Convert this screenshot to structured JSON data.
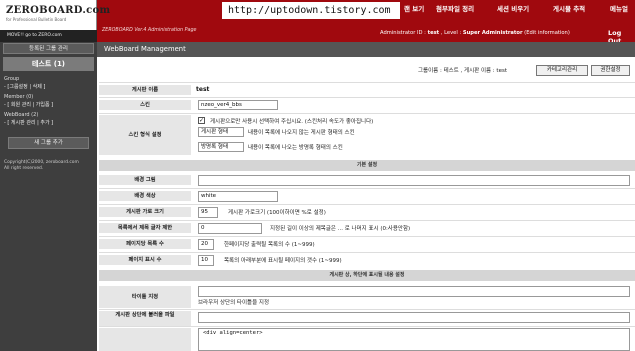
{
  "header": {
    "logo_title": "ZEROBOARD.com",
    "logo_subtitle": "for Professional Bulletin Board",
    "logo_link": "MOVE!! go to ZERO.com",
    "admin_subtitle": "ZEROBOARD Ver.4 Administration Page",
    "url_overlay": "http://uptodown.tistory.com",
    "menu": [
      "랜 보기",
      "첨부파일 정리",
      "세션 비우기",
      "게시물 추적",
      "메뉴얼"
    ],
    "logout": "Log Out",
    "admin_id_label": "Administrator ID :",
    "admin_id": "test",
    "level_label": ", Level :",
    "level": "Super Administrator",
    "edit_info": "(Edit information)"
  },
  "sidebar": {
    "register_group": "등록된 그룹 관리",
    "group_title": "테스트 (1)",
    "group_label": "Group",
    "group_links": "- [그룹설정 | 삭제 ]",
    "member_label": "Member (0)",
    "member_links": "- [ 회원 관리 | 가입폼 ]",
    "webboard_label": "WebBoard (2)",
    "webboard_links": "- [ 게시판 관리 | 추가 ]",
    "add_group": "새 그룹 추가",
    "copyright": "Copyright(C)2000, zeroboard.com",
    "rights": "All right reserved."
  },
  "main": {
    "title": "WebBoard Management",
    "breadcrumb": "그룹이름 : 테스트 , 게시판 이름 : test",
    "btn_category": "카테고리관리",
    "btn_permission": "권한설정",
    "rows": {
      "board_name_label": "게시판 이름",
      "board_name": "test",
      "skin_label": "스킨",
      "skin_value": "nzeo_ver4_bbs",
      "skin_type_label": "스킨 형식 설정",
      "skin_checkbox_text": "게시판으로만 사용시 선택하여 주십시요. (스킨처리 속도가 좋아집니다)",
      "skin_checked": "✓",
      "skin_board_select": "게시판 형태",
      "skin_board_desc": "내용이 목록에 나오지 않는 게시판 형태의 스킨",
      "skin_guest_select": "방명록 형태",
      "skin_guest_desc": "내용이 목록에 나오는 방명록 형태의 스킨",
      "basic_section": "기본 설정",
      "bg_image_label": "배경 그림",
      "bg_color_label": "배경 색상",
      "bg_color": "white",
      "width_label": "게시판 가로 크기",
      "width_value": "95",
      "width_desc": "게시판 가로크기 (100이하이면 %로 설정)",
      "title_limit_label": "목록에서 제목 글자 제한",
      "title_limit_value": "0",
      "title_limit_desc": "지정된 길이 이상의 제목글은 ... 로 나머지 표시 (0:사용안함)",
      "per_page_label": "페이지당 목록 수",
      "per_page_value": "20",
      "per_page_desc": "한페이지당 출력될 목록의 수 (1~999)",
      "page_count_label": "페이지 표시 수",
      "page_count_value": "10",
      "page_count_desc": "목록의 아래부분에 표시될 페이지의 갯수 (1~999)",
      "top_section": "게시판 상, 하단에 표시될 내용 설정",
      "title_tag_label": "타이틀 지정",
      "title_tag_desc": "브라우저 상단의 타이틀을 지정",
      "header_file_label": "게시판 상단에 불러올 파일",
      "header_html_value": "<div align=center>"
    }
  }
}
